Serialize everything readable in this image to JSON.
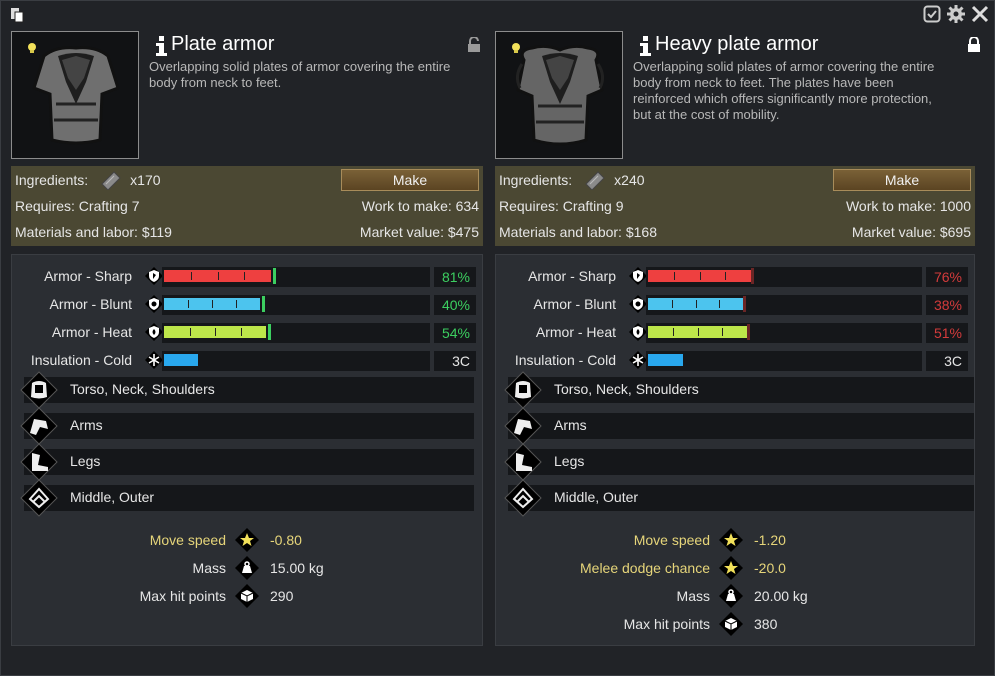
{
  "window": {
    "icons": [
      "copy-icon",
      "checkbox-icon",
      "gear-icon",
      "close-icon"
    ]
  },
  "items": [
    {
      "title": "Plate armor",
      "locked": "unlocked-lock-icon",
      "description_lines": [
        "Overlapping solid plates of armor covering the entire",
        "body from neck to feet."
      ],
      "ingredients_label": "Ingredients:",
      "ingredients_qty": "x170",
      "make_label": "Make",
      "requires": "Requires: Crafting 7",
      "work": "Work to make: 634",
      "materials": "Materials and labor: $119",
      "market": "Market value: $475",
      "stats": [
        {
          "label": "Armor - Sharp",
          "value": "81%",
          "fraction": 0.81,
          "color": "#ee4040",
          "status": "green"
        },
        {
          "label": "Armor - Blunt",
          "value": "40%",
          "fraction": 0.73,
          "color": "#4cc4ee",
          "status": "green"
        },
        {
          "label": "Armor - Heat",
          "value": "54%",
          "fraction": 0.77,
          "color": "#bde64a",
          "status": "green"
        },
        {
          "label": "Insulation - Cold",
          "value": "3C",
          "fraction": 0.26,
          "color": "#29a8ee",
          "status": "neutral"
        }
      ],
      "coverage": [
        "Torso, Neck, Shoulders",
        "Arms",
        "Legs",
        "Middle, Outer"
      ],
      "attributes": [
        {
          "label": "Move speed",
          "value": "-0.80",
          "icon": "star-icon",
          "highlight": true
        },
        {
          "label": "Mass",
          "value": "15.00 kg",
          "icon": "weight-icon",
          "highlight": false
        },
        {
          "label": "Max hit points",
          "value": "290",
          "icon": "cube-icon",
          "highlight": false
        }
      ]
    },
    {
      "title": "Heavy plate armor",
      "locked": "lock-icon",
      "description_lines": [
        "Overlapping solid plates of armor covering the entire",
        "body from neck to feet. The plates have been",
        "reinforced which offers significantly more protection,",
        "but at the cost of mobility."
      ],
      "ingredients_label": "Ingredients:",
      "ingredients_qty": "x240",
      "make_label": "Make",
      "requires": "Requires: Crafting 9",
      "work": "Work to make: 1000",
      "materials": "Materials and labor: $168",
      "market": "Market value: $695",
      "stats": [
        {
          "label": "Armor - Sharp",
          "value": "76%",
          "fraction": 0.76,
          "color": "#ee4040",
          "status": "red"
        },
        {
          "label": "Armor - Blunt",
          "value": "38%",
          "fraction": 0.7,
          "color": "#4cc4ee",
          "status": "red"
        },
        {
          "label": "Armor - Heat",
          "value": "51%",
          "fraction": 0.73,
          "color": "#bde64a",
          "status": "red"
        },
        {
          "label": "Insulation - Cold",
          "value": "3C",
          "fraction": 0.26,
          "color": "#29a8ee",
          "status": "neutral"
        }
      ],
      "coverage": [
        "Torso, Neck, Shoulders",
        "Arms",
        "Legs",
        "Middle, Outer"
      ],
      "attributes": [
        {
          "label": "Move speed",
          "value": "-1.20",
          "icon": "star-icon",
          "highlight": true
        },
        {
          "label": "Melee dodge chance",
          "value": "-20.0",
          "icon": "star-icon",
          "highlight": true
        },
        {
          "label": "Mass",
          "value": "20.00 kg",
          "icon": "weight-icon",
          "highlight": false
        },
        {
          "label": "Max hit points",
          "value": "380",
          "icon": "cube-icon",
          "highlight": false
        }
      ]
    }
  ]
}
